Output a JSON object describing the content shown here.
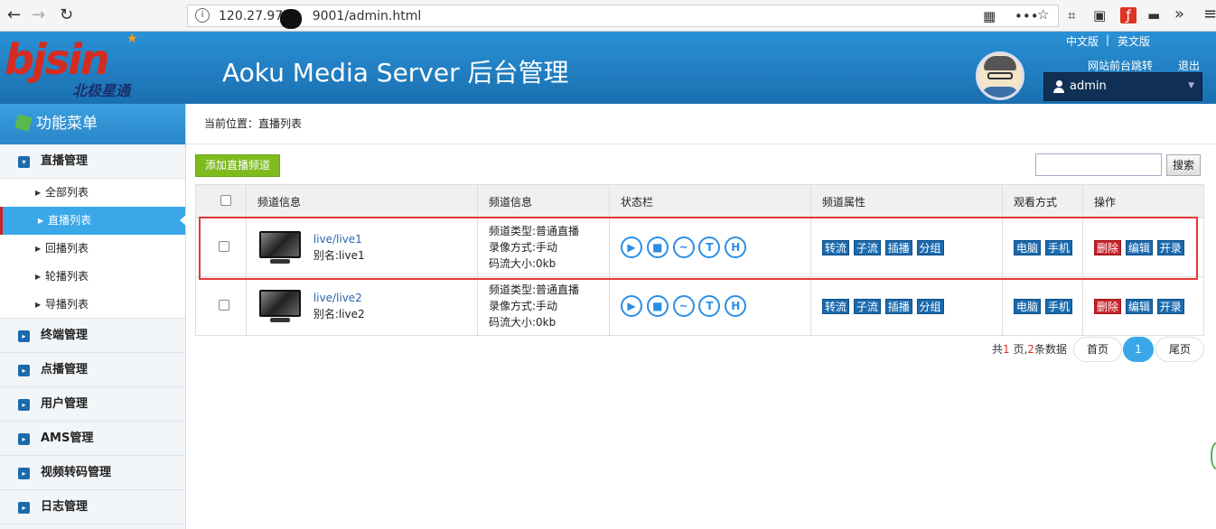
{
  "browser": {
    "url_visible": "120.27.97.",
    "url_tail": "9001/admin.html",
    "back_icon": "arrow-left-icon",
    "forward_icon": "arrow-right-icon",
    "reload_icon": "reload-icon",
    "toolbar_icons": [
      "qr-icon",
      "more-icon",
      "star-icon",
      "crop-icon",
      "reader-icon",
      "flash-icon",
      "menu-box-icon",
      "overflow-icon",
      "hamburger-icon"
    ],
    "glyphs": {
      "back": "←",
      "forward": "→",
      "reload": "↻",
      "qr": "▦",
      "more": "•••",
      "star": "☆",
      "crop": "⌗",
      "reader": "▣",
      "flash": "ƒ",
      "box": "▬",
      "overflow": "»",
      "menu": "≡",
      "info": "i"
    }
  },
  "header": {
    "logo_text": "bjsin",
    "logo_sub": "北极星通",
    "title": "Aoku Media Server 后台管理",
    "lang_cn": "中文版",
    "lang_sep": "|",
    "lang_en": "英文版",
    "front_link": "网站前台跳转",
    "logout": "退出",
    "username": "admin"
  },
  "sidebar": {
    "title": "功能菜单",
    "menus": [
      {
        "label": "直播管理",
        "icon": "▾",
        "sub": [
          "全部列表",
          "直播列表",
          "回播列表",
          "轮播列表",
          "导播列表"
        ]
      },
      {
        "label": "终端管理",
        "icon": "▸"
      },
      {
        "label": "点播管理",
        "icon": "▸"
      },
      {
        "label": "用户管理",
        "icon": "▸"
      },
      {
        "label": "AMS管理",
        "icon": "▸"
      },
      {
        "label": "视频转码管理",
        "icon": "▸"
      },
      {
        "label": "日志管理",
        "icon": "▸"
      }
    ],
    "active_sub": "直播列表",
    "sub_arrow": "▶"
  },
  "breadcrumb": "当前位置：直播列表",
  "toolbar": {
    "add_label": "添加直播频道",
    "search_label": "搜索",
    "search_value": ""
  },
  "table": {
    "headers": [
      "频道信息",
      "频道信息",
      "状态栏",
      "频道属性",
      "观看方式",
      "操作"
    ],
    "rows": [
      {
        "name": "live/live1",
        "alias": "别名:live1",
        "type": "频道类型:普通直播",
        "record": "录像方式:手动",
        "bitrate": "码流大小:0kb"
      },
      {
        "name": "live/live2",
        "alias": "别名:live2",
        "type": "频道类型:普通直播",
        "record": "录像方式:手动",
        "bitrate": "码流大小:0kb"
      }
    ],
    "status_icons": [
      {
        "name": "play-icon",
        "glyph": "▶"
      },
      {
        "name": "camera-icon",
        "glyph": "■"
      },
      {
        "name": "wave-icon",
        "glyph": "~"
      },
      {
        "name": "t-icon",
        "glyph": "T"
      },
      {
        "name": "h-icon",
        "glyph": "H"
      }
    ],
    "attr_tags": [
      "转流",
      "子流",
      "插播",
      "分组"
    ],
    "view_tags": [
      "电脑",
      "手机"
    ],
    "op_tags": [
      "删除",
      "编辑",
      "开录"
    ]
  },
  "pagination": {
    "total_prefix": "共",
    "pages": "1",
    "pages_mid": " 页,",
    "records": "2",
    "records_suffix": "条数据",
    "first": "首页",
    "current": "1",
    "last": "尾页"
  },
  "colors": {
    "accent": "#3aa8e8",
    "header": "#2a91d6",
    "add_button": "#7dbb1f",
    "tag_blue": "#1b6aad",
    "tag_red": "#c8232a",
    "highlight": "#e53935"
  }
}
